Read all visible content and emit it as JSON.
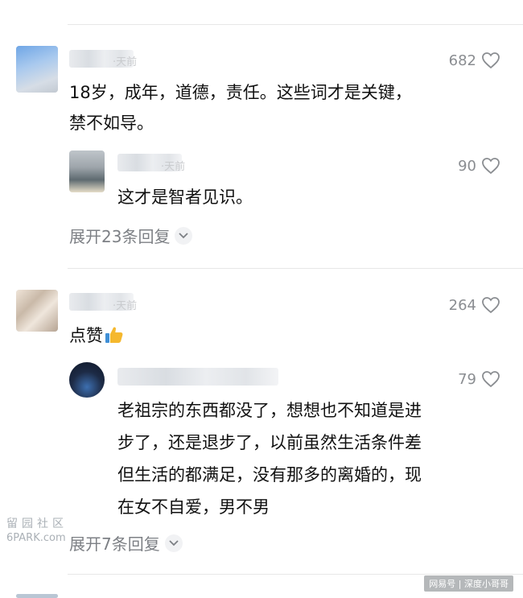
{
  "comments": [
    {
      "likes": "682",
      "text": "18岁，成年，道德，责任。这些词才是关键，\n禁不如导。",
      "reply": {
        "likes": "90",
        "text": "这才是智者见识。"
      },
      "expand_label": "展开23条回复"
    },
    {
      "likes": "264",
      "text": "点赞",
      "text_emoji": "thumbs-up-emoji",
      "reply": {
        "likes": "79",
        "text": "老祖宗的东西都没了，想想也不知道是进\n步了，还是退步了，以前虽然生活条件差\n但生活的都满足，没有那多的离婚的，现\n在女不自爱，男不男"
      },
      "expand_label": "展开7条回复"
    }
  ],
  "watermarks": {
    "left_cn": "留园社区",
    "left_en": "6PARK.com",
    "right": "网易号 | 深度小哥哥"
  },
  "colors": {
    "text": "#111111",
    "meta": "#8a8d91",
    "divider": "#e7e7e7"
  },
  "icons": {
    "like": "heart-outline-icon",
    "expand": "chevron-down-icon"
  }
}
